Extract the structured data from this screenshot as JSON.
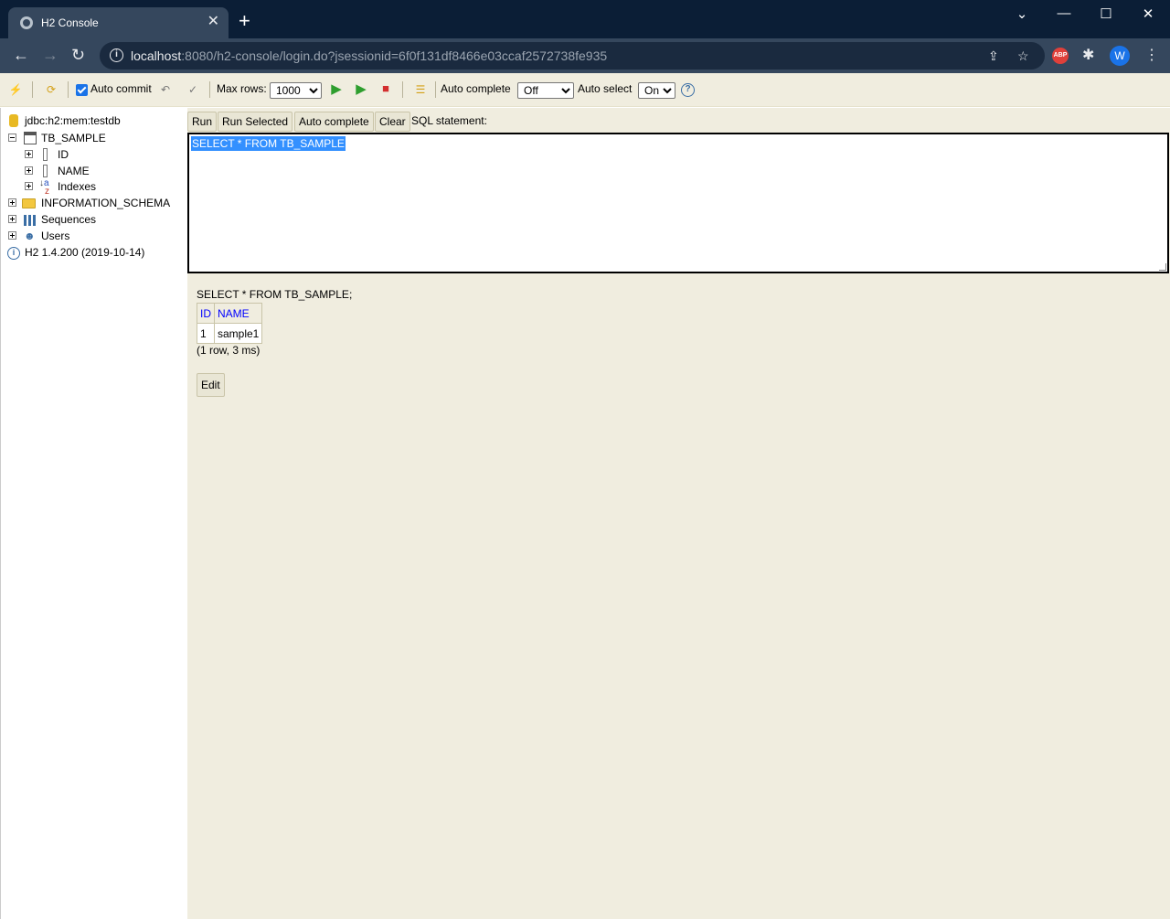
{
  "browser": {
    "tab_title": "H2 Console",
    "tab_close": "✕",
    "new_tab": "+",
    "url_host": "localhost",
    "url_rest": ":8080/h2-console/login.do?jsessionid=6f0f131df8466e03ccaf2572738fe935",
    "abp_label": "ABP",
    "avatar_initial": "W"
  },
  "toolbar": {
    "auto_commit_label": "Auto commit",
    "auto_commit_checked": true,
    "max_rows_label": "Max rows:",
    "max_rows_value": "1000",
    "auto_complete_label": "Auto complete",
    "auto_complete_value": "Off",
    "auto_select_label": "Auto select",
    "auto_select_value": "On",
    "help_glyph": "?"
  },
  "tree": {
    "connection": "jdbc:h2:mem:testdb",
    "table": "TB_SAMPLE",
    "columns": [
      "ID",
      "NAME"
    ],
    "indexes": "Indexes",
    "information_schema": "INFORMATION_SCHEMA",
    "sequences": "Sequences",
    "users": "Users",
    "version": "H2 1.4.200 (2019-10-14)"
  },
  "main": {
    "buttons": {
      "run": "Run",
      "run_selected": "Run Selected",
      "auto_complete": "Auto complete",
      "clear": "Clear"
    },
    "sql_label": "SQL statement:",
    "editor_text": "SELECT * FROM TB_SAMPLE",
    "result_query": "SELECT * FROM TB_SAMPLE;",
    "result_headers": [
      "ID",
      "NAME"
    ],
    "result_rows": [
      [
        "1",
        "sample1"
      ]
    ],
    "result_summary": "(1 row, 3 ms)",
    "edit_button": "Edit"
  }
}
